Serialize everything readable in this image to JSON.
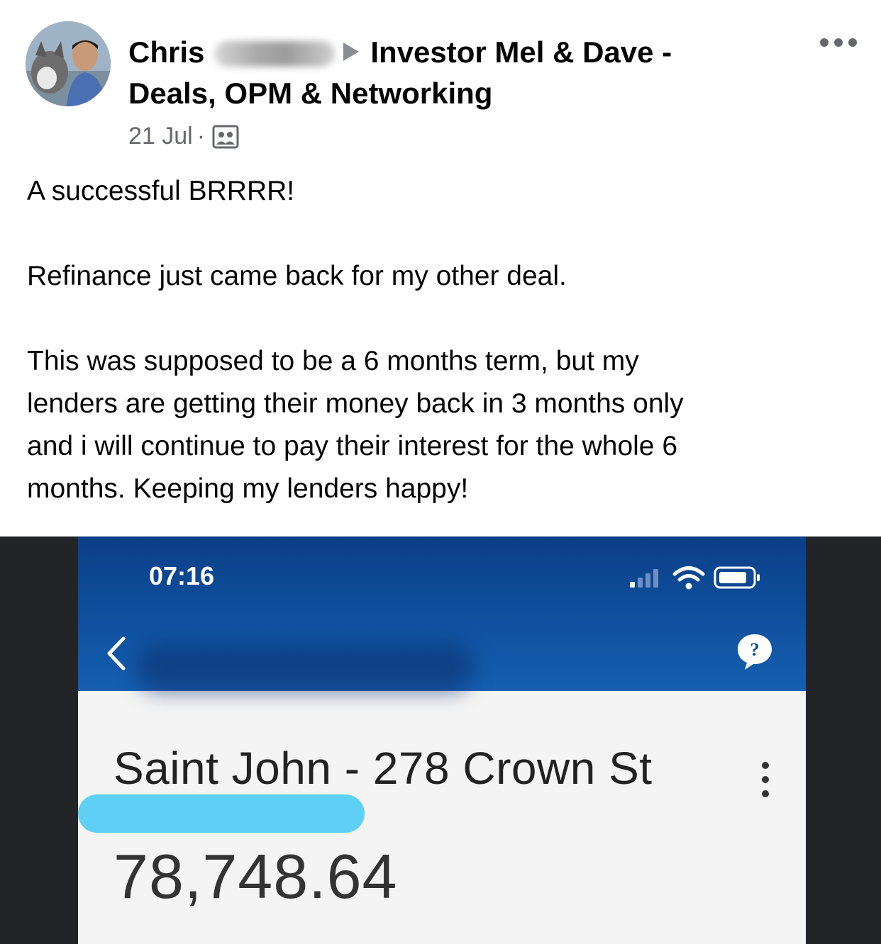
{
  "post": {
    "author": "Chris",
    "group": "Investor Mel & Dave -",
    "group_cont": "Deals, OPM & Networking",
    "date": "21 Jul",
    "separator": "·",
    "audience_icon": "group-members-icon",
    "more_icon": "more-options-icon",
    "text": {
      "p1": "A successful BRRRR!",
      "p2": "Refinance just came back for my other deal.",
      "p3_lines": [
        "This was supposed to be a 6 months term, but my",
        "lenders are getting their money back in 3 months only",
        "and i will continue to pay their interest for the whole 6",
        "months. Keeping my lenders happy!"
      ]
    }
  },
  "photo": {
    "status_time": "07:16",
    "account_name": "Saint John - 278 Crown St",
    "balance": "78,748.64",
    "icons": {
      "back": "back-chevron-icon",
      "help": "help-bubble-icon",
      "menu": "kebab-menu-icon"
    },
    "colors": {
      "header_blue": "#0d4d9b",
      "highlight": "#5fd0f5",
      "photo_border": "#232428"
    }
  }
}
